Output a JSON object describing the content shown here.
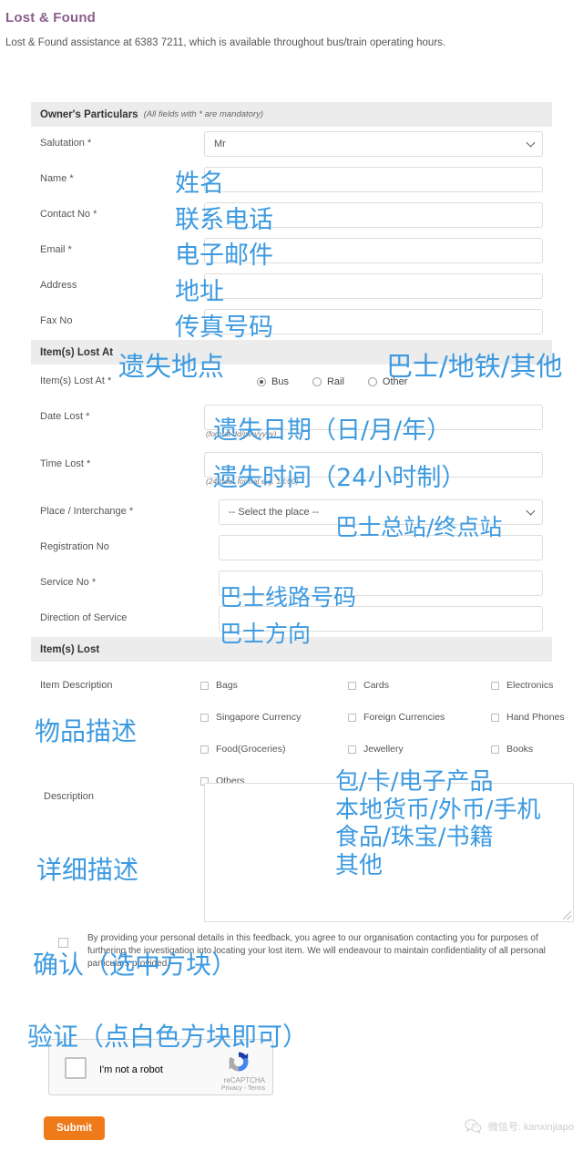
{
  "page": {
    "title": "Lost & Found",
    "intro": "Lost & Found assistance at 6383 7211, which is available throughout bus/train operating hours."
  },
  "sections": {
    "owner": {
      "heading": "Owner's Particulars",
      "note": "(All fields with * are mandatory)"
    },
    "lost_at": {
      "heading": "Item(s) Lost At"
    },
    "items_lost": {
      "heading": "Item(s) Lost"
    }
  },
  "owner_fields": {
    "salutation": {
      "label": "Salutation *",
      "value": "Mr"
    },
    "name": {
      "label": "Name *",
      "value": ""
    },
    "contact_no": {
      "label": "Contact No *",
      "value": ""
    },
    "email": {
      "label": "Email *",
      "value": ""
    },
    "address": {
      "label": "Address",
      "value": ""
    },
    "fax_no": {
      "label": "Fax No",
      "value": ""
    }
  },
  "lost_at_fields": {
    "lost_at": {
      "label": "Item(s) Lost At *",
      "options": [
        "Bus",
        "Rail",
        "Other"
      ],
      "selected": "Bus"
    },
    "date_lost": {
      "label": "Date Lost *",
      "value": "",
      "hint": "(format dd/mm/yyyy)"
    },
    "time_lost": {
      "label": "Time Lost *",
      "value": "",
      "hint": "(24-hour format e.g. 13:00)"
    },
    "place": {
      "label": "Place / Interchange *",
      "value": "-- Select the place --"
    },
    "registration_no": {
      "label": "Registration No",
      "value": ""
    },
    "service_no": {
      "label": "Service No *",
      "value": ""
    },
    "direction": {
      "label": "Direction of Service",
      "value": ""
    }
  },
  "items_lost": {
    "item_description_label": "Item Description",
    "checkboxes": [
      {
        "label": "Bags",
        "col": 0,
        "row": 0
      },
      {
        "label": "Cards",
        "col": 1,
        "row": 0
      },
      {
        "label": "Electronics",
        "col": 2,
        "row": 0
      },
      {
        "label": "Singapore Currency",
        "col": 0,
        "row": 1
      },
      {
        "label": "Foreign Currencies",
        "col": 1,
        "row": 1
      },
      {
        "label": "Hand Phones",
        "col": 2,
        "row": 1
      },
      {
        "label": "Food(Groceries)",
        "col": 0,
        "row": 2
      },
      {
        "label": "Jewellery",
        "col": 1,
        "row": 2
      },
      {
        "label": "Books",
        "col": 2,
        "row": 2
      },
      {
        "label": "Others",
        "col": 0,
        "row": 3
      }
    ],
    "description_label": "Description",
    "description_value": ""
  },
  "consent": {
    "text": "By providing your personal details in this feedback, you agree to our organisation contacting you for purposes of furthering the investigation into locating your lost item. We will endeavour to maintain confidentiality of all personal particulars provided."
  },
  "recaptcha": {
    "label": "I'm not a robot",
    "brand": "reCAPTCHA",
    "legal": "Privacy - Terms"
  },
  "submit": {
    "label": "Submit"
  },
  "watermark": {
    "text": "微信号: kanxinjiapo"
  },
  "annotations": {
    "accent_color": "#3d9ae0",
    "name": "姓名",
    "contact": "联系电话",
    "email": "电子邮件",
    "address": "地址",
    "fax": "传真号码",
    "lost_at": "遗失地点",
    "lost_at_opts": "巴士/地铁/其他",
    "date_lost": "遗失日期（日/月/年）",
    "time_lost": "遗失时间（24小时制）",
    "place": "巴士总站/终点站",
    "service_no": "巴士线路号码",
    "direction": "巴士方向",
    "item_desc": "物品描述",
    "items_list": "包/卡/电子产品\n本地货币/外币/手机\n食品/珠宝/书籍\n其他",
    "description": "详细描述",
    "confirm": "确认（选中方块）",
    "verify": "验证（点白色方块即可）"
  }
}
